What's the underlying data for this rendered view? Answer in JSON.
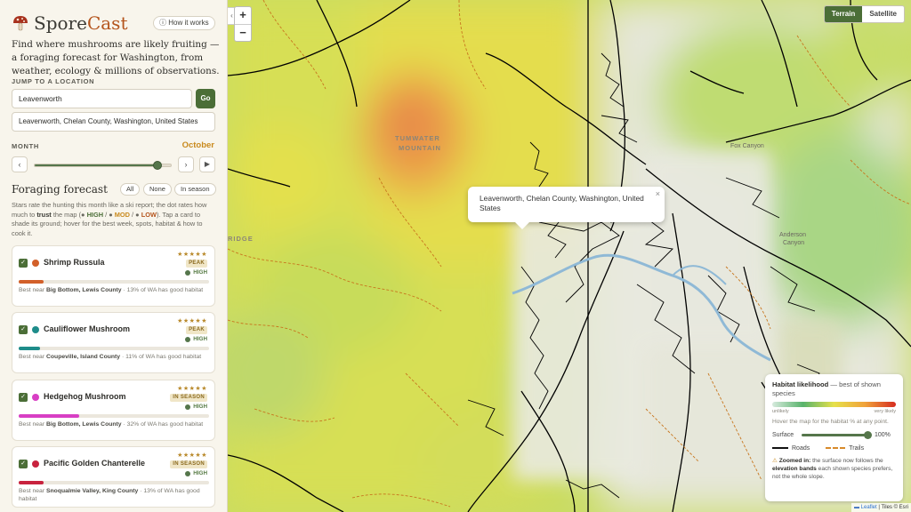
{
  "app": {
    "name_part1": "Spore",
    "name_part2": "Cast",
    "how_label": "How it works",
    "tagline": "Find where mushrooms are likely fruiting — a foraging forecast for Washington, from weather, ecology & millions of observations."
  },
  "location": {
    "section_label": "JUMP TO A LOCATION",
    "search_value": "Leavenworth",
    "go_label": "Go",
    "result": "Leavenworth, Chelan County, Washington, United States"
  },
  "month": {
    "label": "MONTH",
    "value": "October",
    "position": 0.9,
    "prev_label": "‹",
    "next_label": "›",
    "play_label": "▶"
  },
  "forecast": {
    "title": "Foraging forecast",
    "filters": [
      "All",
      "None",
      "In season"
    ],
    "intro_a": "Stars rate the hunting this month like a ski report; the dot rates how much to ",
    "intro_trust": "trust",
    "intro_b": " the map (● ",
    "intro_high": "HIGH",
    "intro_sep1": " / ● ",
    "intro_mod": "MOD",
    "intro_sep2": " / ● ",
    "intro_low": "LOW",
    "intro_c": "). Tap a card to shade its ground; hover for the best week, spots, habitat & how to cook it.",
    "species": [
      {
        "name": "Shrimp Russula",
        "color": "#d2602a",
        "stars": "★★★★★",
        "status": "PEAK",
        "trust": "HIGH",
        "fraction": 0.13,
        "best_prefix": "Best near ",
        "best_place": "Big Bottom, Lewis County",
        "best_suffix": " · 13% of WA has good habitat"
      },
      {
        "name": "Cauliflower Mushroom",
        "color": "#1e8c8a",
        "stars": "★★★★★",
        "status": "PEAK",
        "trust": "HIGH",
        "fraction": 0.11,
        "best_prefix": "Best near ",
        "best_place": "Coupeville, Island County",
        "best_suffix": " · 11% of WA has good habitat"
      },
      {
        "name": "Hedgehog Mushroom",
        "color": "#d83fc4",
        "stars": "★★★★★",
        "status": "IN SEASON",
        "trust": "HIGH",
        "fraction": 0.32,
        "best_prefix": "Best near ",
        "best_place": "Big Bottom, Lewis County",
        "best_suffix": " · 32% of WA has good habitat"
      },
      {
        "name": "Pacific Golden Chanterelle",
        "color": "#c8223e",
        "stars": "★★★★★",
        "status": "IN SEASON",
        "trust": "HIGH",
        "fraction": 0.13,
        "best_prefix": "Best near ",
        "best_place": "Snoqualmie Valley, King County",
        "best_suffix": " · 13% of WA has good habitat"
      }
    ]
  },
  "map": {
    "zoom_in": "+",
    "zoom_out": "−",
    "collapse": "‹",
    "layer_terrain": "Terrain",
    "layer_satellite": "Satellite",
    "labels": {
      "mountain1": "TUMWATER",
      "mountain2": "MOUNTAIN",
      "ridge": "RIDGE",
      "anderson1": "Anderson",
      "anderson2": "Canyon",
      "fox": "Fox Canyon"
    },
    "popup": {
      "text": "Leavenworth, Chelan County, Washington, United States",
      "close": "×"
    },
    "legend": {
      "title_bold": "Habitat likelihood",
      "title_rest": " — best of shown species",
      "low": "unlikely",
      "high": "very likely",
      "hint": "Hover the map for the habitat % at any point.",
      "surface_label": "Surface",
      "surface_value": "100%",
      "surface_level": 1.0,
      "roads_label": "Roads",
      "trails_label": "Trails",
      "zoom_icon": "⚠",
      "zoom_bold1": "Zoomed in:",
      "zoom_text1": " the surface now follows the ",
      "zoom_bold2": "elevation bands",
      "zoom_text2": " each shown species prefers, not the whole slope."
    },
    "attribution": {
      "flag": "▬",
      "leaflet": "Leaflet",
      "rest": " | Tiles © Esri"
    }
  }
}
